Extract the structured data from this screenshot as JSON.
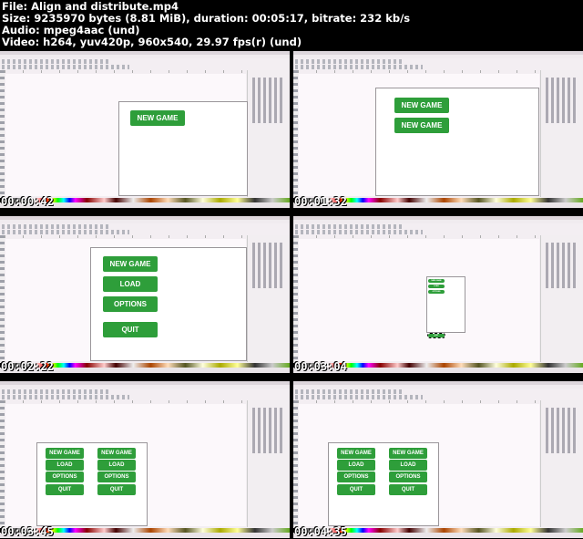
{
  "header": {
    "file": "File: Align and distribute.mp4",
    "size": "Size: 9235970 bytes (8.81 MiB), duration: 00:05:17, bitrate: 232 kb/s",
    "audio": "Audio: mpeg4aac (und)",
    "video": "Video: h264, yuv420p, 960x540, 29.97 fps(r) (und)"
  },
  "thumbnails": [
    {
      "timestamp": "00:00:42"
    },
    {
      "timestamp": "00:01:32"
    },
    {
      "timestamp": "00:02:22"
    },
    {
      "timestamp": "00:03:04"
    },
    {
      "timestamp": "00:03:45"
    },
    {
      "timestamp": "00:04:35"
    }
  ],
  "buttons": {
    "new_game": "NEW GAME",
    "load": "LOAD",
    "options": "OPTIONS",
    "quit": "QUIT"
  },
  "colors": {
    "button_green": "#2e9e3a",
    "background": "#000000"
  }
}
